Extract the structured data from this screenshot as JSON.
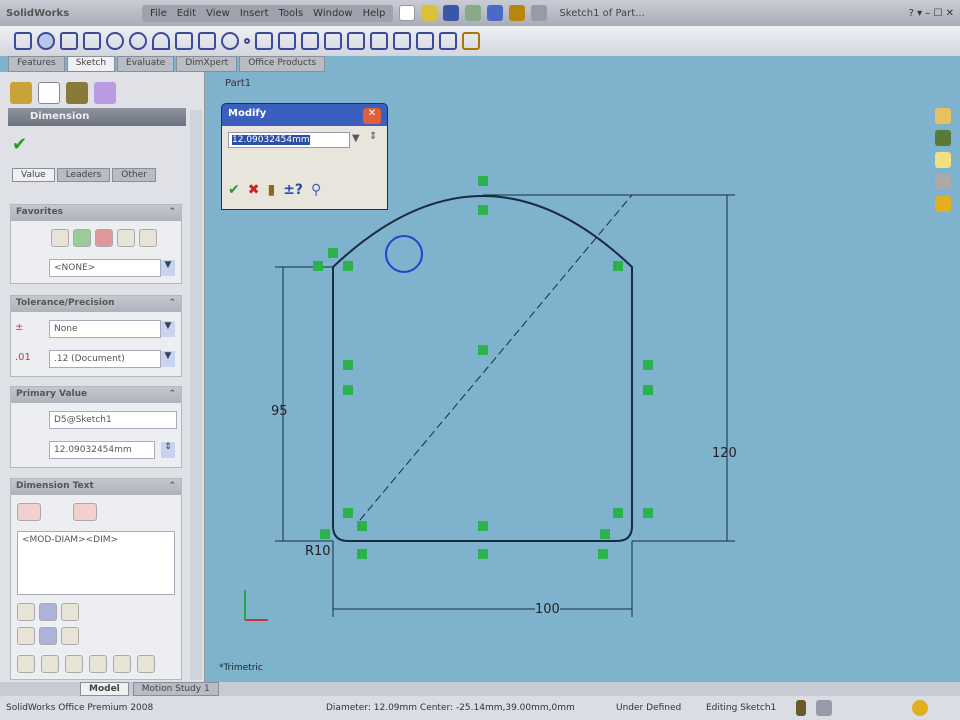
{
  "app": {
    "name": "SolidWorks",
    "doc_title": "Sketch1 of Part..."
  },
  "menu": [
    "File",
    "Edit",
    "View",
    "Insert",
    "Tools",
    "Window",
    "Help"
  ],
  "command_tabs": [
    "Features",
    "Sketch",
    "Evaluate",
    "DimXpert",
    "Office Products"
  ],
  "tree": {
    "part": "Part1"
  },
  "panel": {
    "title": "Dimension",
    "tabs": [
      "Value",
      "Leaders",
      "Other"
    ],
    "favorites": {
      "title": "Favorites",
      "select": "<NONE>"
    },
    "tolerance": {
      "title": "Tolerance/Precision",
      "type": "None",
      "precision": ".12 (Document)"
    },
    "primary": {
      "title": "Primary Value",
      "name": "D5@Sketch1",
      "value": "12.09032454mm"
    },
    "dimtext": {
      "title": "Dimension Text",
      "text": "<MOD-DIAM><DIM>"
    }
  },
  "modify": {
    "title": "Modify",
    "value": "12.09032454mm"
  },
  "sketch": {
    "dims": {
      "d95": "95",
      "d120": "120",
      "d100": "100",
      "r10": "R10"
    }
  },
  "view_label": "*Trimetric",
  "bottom_tabs": [
    "Model",
    "Motion Study 1"
  ],
  "status": {
    "product": "SolidWorks Office Premium 2008",
    "diameter": "Diameter: 12.09mm  Center: -25.14mm,39.00mm,0mm",
    "state": "Under Defined",
    "editing": "Editing Sketch1"
  }
}
